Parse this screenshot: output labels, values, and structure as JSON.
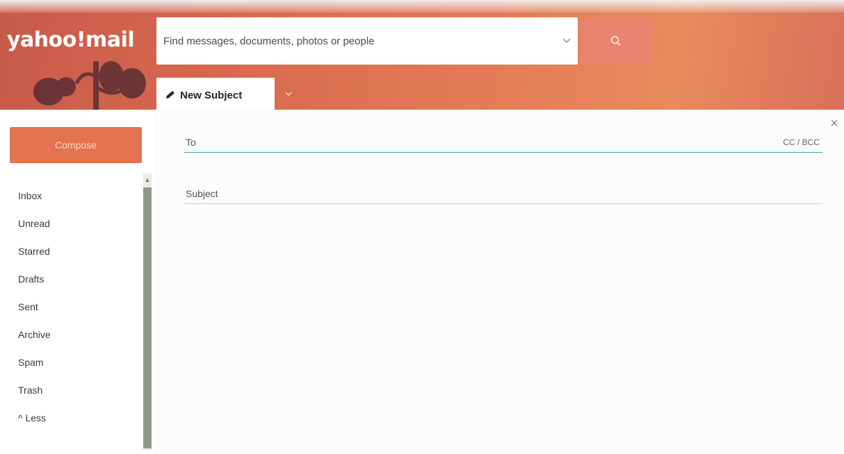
{
  "app": {
    "logo_text": "yahoo!mail"
  },
  "search": {
    "placeholder": "Find messages, documents, photos or people",
    "dropdown_icon": "chevron-down-icon",
    "button_icon": "search-icon"
  },
  "tabs": [
    {
      "label": "New Subject",
      "icon": "pencil-icon",
      "active": true
    }
  ],
  "sidebar": {
    "compose_label": "Compose",
    "folders": [
      {
        "label": "Inbox"
      },
      {
        "label": "Unread"
      },
      {
        "label": "Starred"
      },
      {
        "label": "Drafts"
      },
      {
        "label": "Sent"
      },
      {
        "label": "Archive"
      },
      {
        "label": "Spam"
      },
      {
        "label": "Trash"
      },
      {
        "label": "^ Less"
      }
    ]
  },
  "compose": {
    "to_label": "To",
    "cc_bcc_label": "CC / BCC",
    "subject_label": "Subject",
    "close_icon": "close-icon"
  },
  "colors": {
    "header_accent": "#d96a50",
    "compose_button": "#e4734f",
    "search_button": "#e8846d",
    "to_field_underline": "#3aa3b8"
  }
}
